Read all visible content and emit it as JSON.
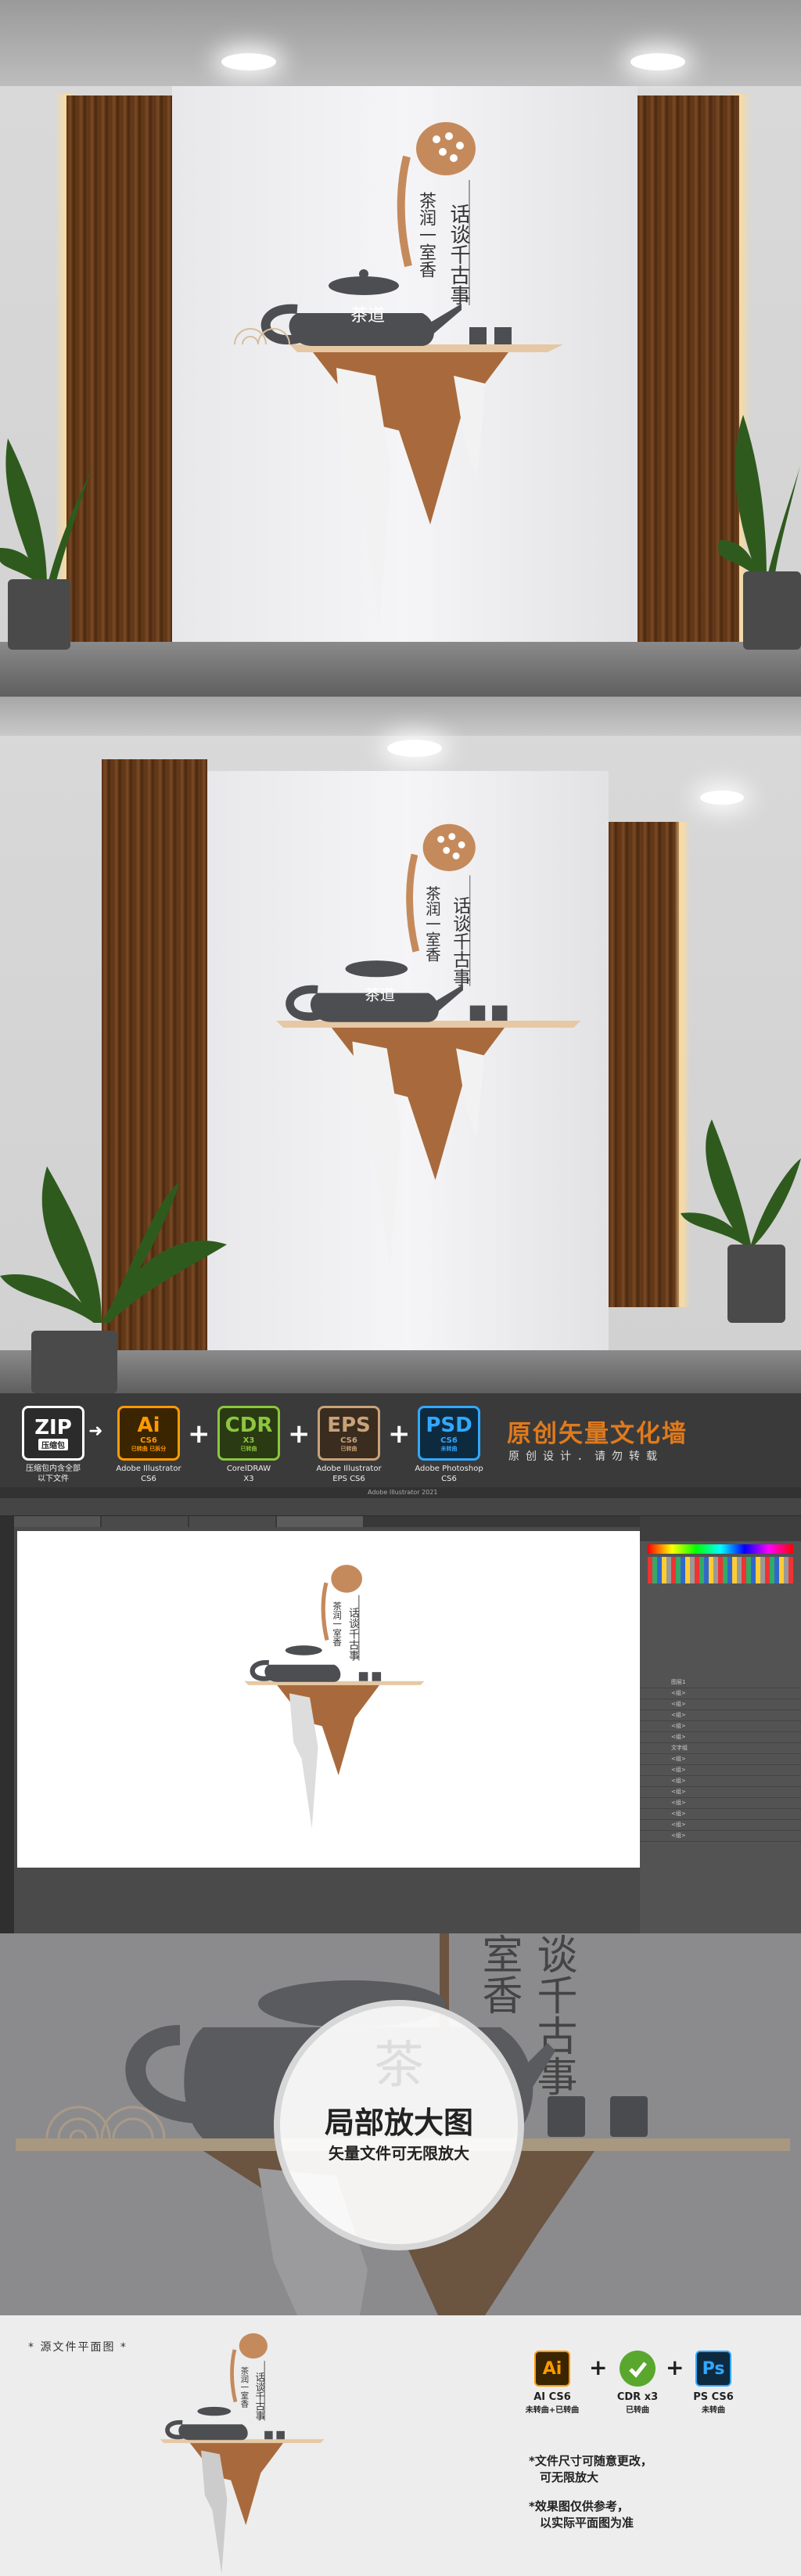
{
  "wall_art": {
    "title_left": "茶润一室香",
    "title_right": "话谈千古事",
    "pot_text": "茶道"
  },
  "tools": {
    "badges": [
      {
        "label": "ZIP",
        "sub": "压缩包",
        "caption": "压缩包内含全部\n以下文件",
        "color": "#ffffff",
        "border": "#ffffff",
        "bg": "#2b2b2b"
      },
      {
        "label": "Ai",
        "sub": "CS6",
        "sub2": "已转曲 已拆分",
        "caption": "Adobe Illustrator\nCS6",
        "color": "#ff9a00",
        "border": "#ff9a00",
        "bg": "#3b2500"
      },
      {
        "label": "CDR",
        "sub": "X3",
        "sub2": "已转曲",
        "caption": "CorelDRAW\nX3",
        "color": "#8cc63f",
        "border": "#8cc63f",
        "bg": "#2a3a12"
      },
      {
        "label": "EPS",
        "sub": "CS6",
        "sub2": "已转曲",
        "caption": "Adobe Illustrator\nEPS CS6",
        "color": "#c8a27a",
        "border": "#c8a27a",
        "bg": "#3a2c1e"
      },
      {
        "label": "PSD",
        "sub": "CS6",
        "sub2": "未转曲",
        "caption": "Adobe Photoshop\nCS6",
        "color": "#31a8ff",
        "border": "#31a8ff",
        "bg": "#0e2a3f"
      }
    ],
    "arrow": "➜",
    "plus": "+",
    "headline": "原创矢量文化墙",
    "subhead": "原创设计．请勿转载",
    "app_title": "Adobe Illustrator 2021",
    "layers": [
      "图层1",
      "<组>",
      "<组>",
      "<组>",
      "<组>",
      "<组>",
      "文字组",
      "<组>",
      "<组>",
      "<组>",
      "<组>",
      "<组>",
      "<组>",
      "<组>",
      "<组>"
    ]
  },
  "zoom": {
    "title": "局部放大图",
    "subtitle": "矢量文件可无限放大",
    "bg_text_1": "室香",
    "bg_text_2": "谈千古事",
    "bg_text_3": "茶"
  },
  "bottom": {
    "source_label": "* 源文件平面图 *",
    "apps": [
      {
        "label": "Ai",
        "caption": "AI CS6",
        "caption2": "未转曲+已转曲",
        "color": "#ff9a00",
        "bg": "#3b2500"
      },
      {
        "label": "",
        "caption": "CDR x3",
        "caption2": "已转曲",
        "color": "#ffffff",
        "bg": "#5aa72e"
      },
      {
        "label": "Ps",
        "caption": "PS CS6",
        "caption2": "未转曲",
        "color": "#31a8ff",
        "bg": "#0e2a3f"
      }
    ],
    "plus": "+",
    "note1_a": "*文件尺寸可随意更改，",
    "note1_b": "可无限放大",
    "note2_a": "*效果图仅供参考，",
    "note2_b": "以实际平面图为准"
  }
}
